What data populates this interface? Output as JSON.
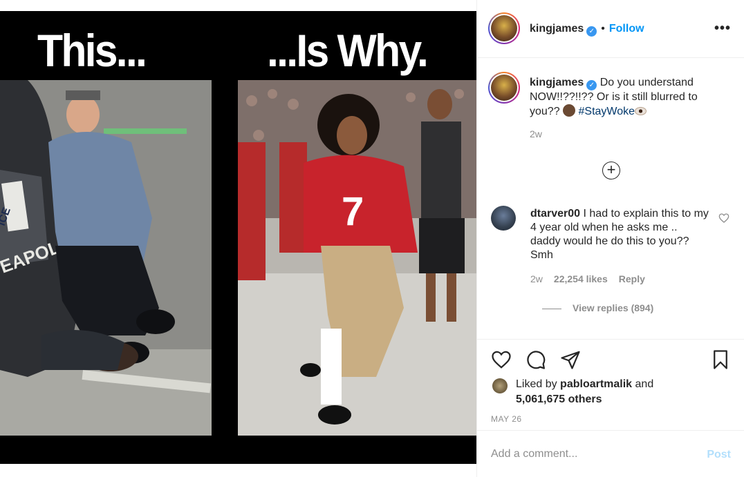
{
  "media": {
    "title_left": "This...",
    "title_right": "...Is Why.",
    "left_panel_signage": "EAPOLIS",
    "left_panel_car_door": "ICE",
    "jersey_number": "7"
  },
  "header": {
    "username": "kingjames",
    "separator": "•",
    "follow_label": "Follow",
    "more_icon": "more-horizontal-icon",
    "more_glyph": "•••"
  },
  "caption": {
    "username": "kingjames",
    "text_part1": "Do you understand NOW!!??!!?? Or is it still blurred to you??",
    "hashtag": "#StayWoke",
    "time": "2w"
  },
  "load_more": {
    "glyph": "+",
    "icon": "plus-circle-icon"
  },
  "comment": {
    "username": "dtarver00",
    "text": "I had to explain this to my 4 year old when he asks me .. daddy would he do this to you?? Smh",
    "time": "2w",
    "likes": "22,254 likes",
    "reply_label": "Reply",
    "view_replies": "View replies (894)"
  },
  "actions": {
    "like_icon": "heart-icon",
    "comment_icon": "comment-icon",
    "share_icon": "send-icon",
    "save_icon": "bookmark-icon"
  },
  "likes": {
    "prefix": "Liked by",
    "user": "pabloartmalik",
    "connector": "and",
    "others": "5,061,675 others"
  },
  "post_date": "MAY 26",
  "add_comment": {
    "placeholder": "Add a comment...",
    "post_label": "Post"
  },
  "colors": {
    "accent": "#0095f6",
    "hashtag": "#00376b",
    "muted": "#8e8e8e",
    "post_disabled": "#b2dffc"
  }
}
